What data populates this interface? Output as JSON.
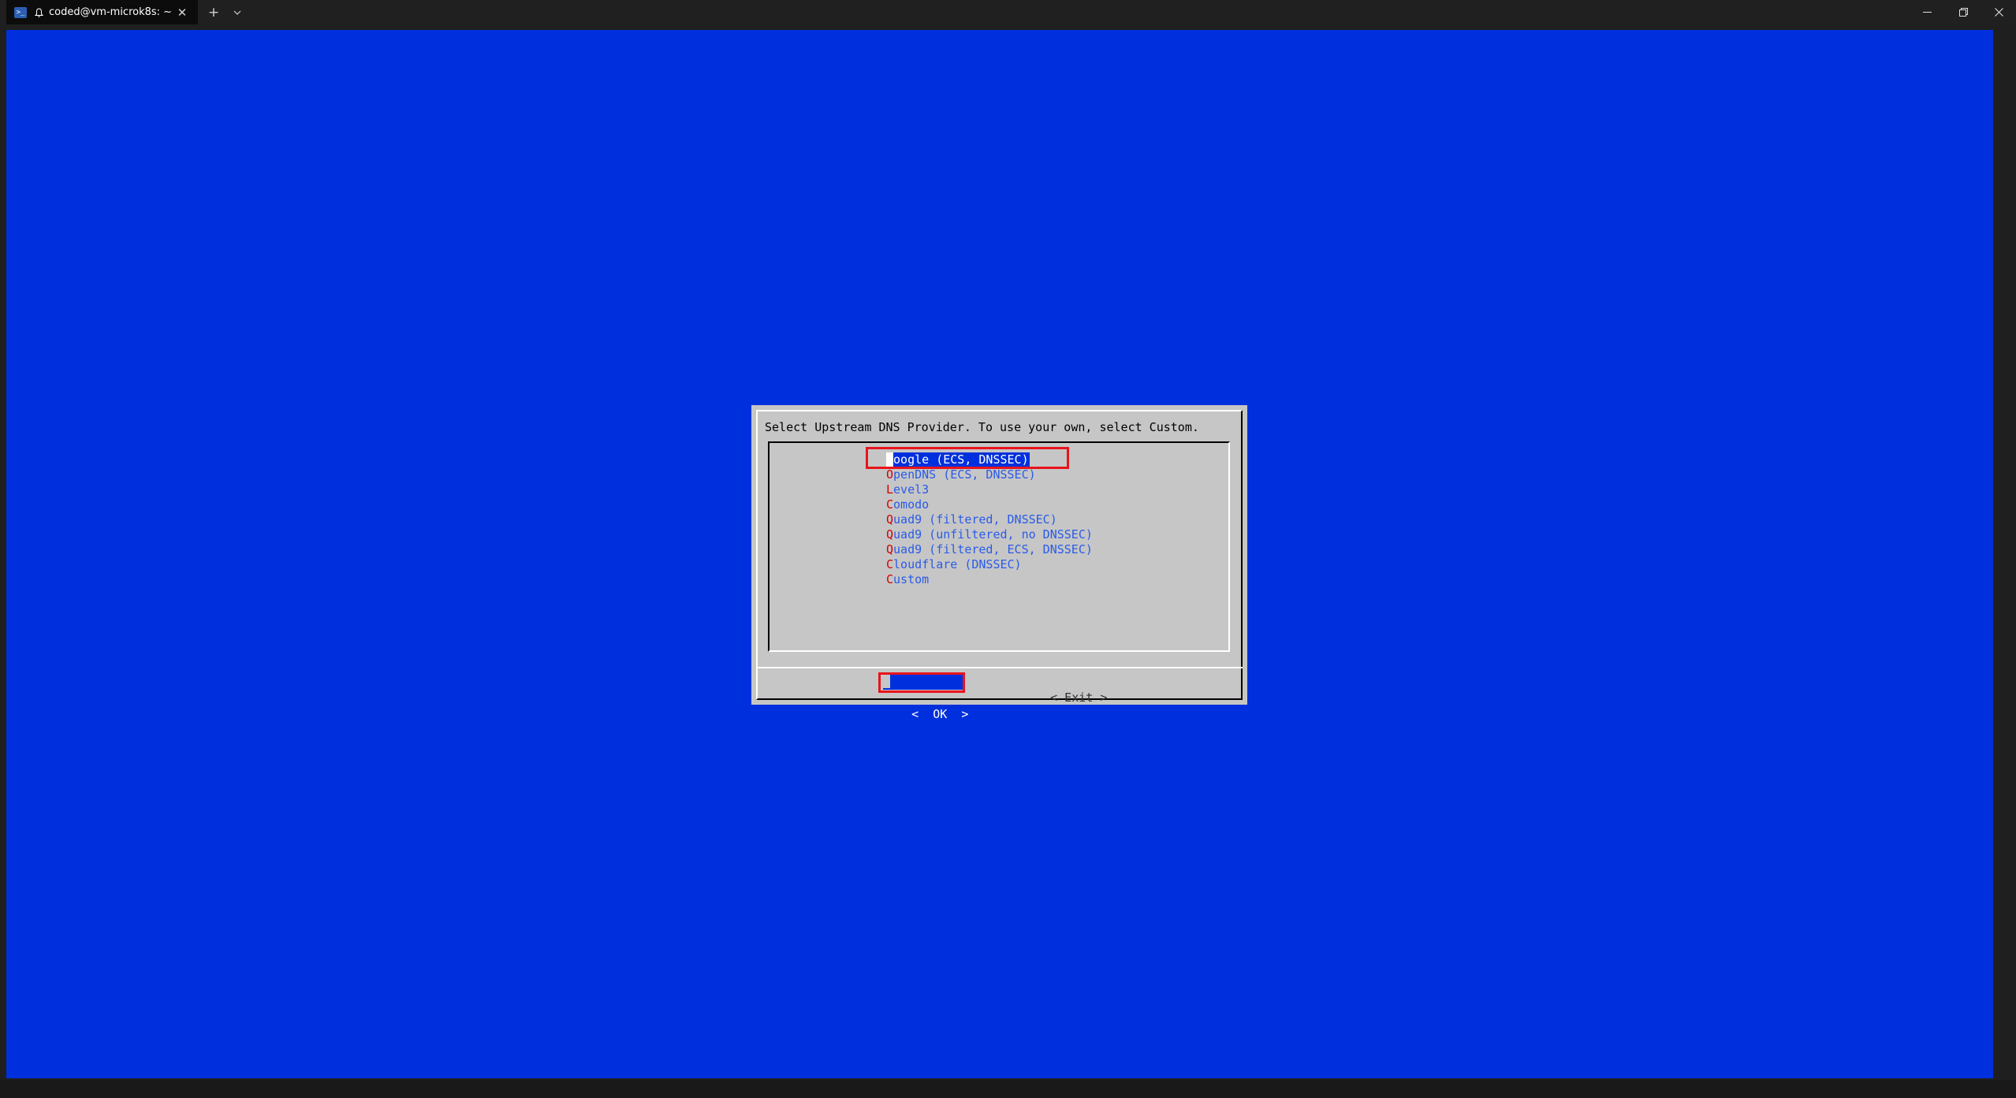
{
  "window": {
    "tab_title": "coded@vm-microk8s: ~",
    "icons": {
      "app": "powershell-icon",
      "notify": "bell-icon",
      "close_tab": "close-icon",
      "new_tab": "plus-icon",
      "dropdown": "chevron-down-icon",
      "minimize": "minimize-icon",
      "maximize": "restore-icon",
      "close": "close-icon"
    },
    "glyphs": {
      "new_tab": "+",
      "dropdown": "⌄",
      "close_tab": "✕",
      "minimize": "—",
      "maximize": "❐",
      "close": "✕"
    }
  },
  "terminal": {
    "background": "#0030dd"
  },
  "dialog": {
    "message": "Select Upstream DNS Provider. To use your own, select Custom.",
    "items": [
      {
        "hot": "G",
        "rest": "oogle (ECS, DNSSEC)",
        "selected": true
      },
      {
        "hot": "O",
        "rest": "penDNS (ECS, DNSSEC)",
        "selected": false
      },
      {
        "hot": "L",
        "rest": "evel3",
        "selected": false
      },
      {
        "hot": "C",
        "rest": "omodo",
        "selected": false
      },
      {
        "hot": "Q",
        "rest": "uad9 (filtered, DNSSEC)",
        "selected": false
      },
      {
        "hot": "Q",
        "rest": "uad9 (unfiltered, no DNSSEC)",
        "selected": false
      },
      {
        "hot": "Q",
        "rest": "uad9 (filtered, ECS, DNSSEC)",
        "selected": false
      },
      {
        "hot": "C",
        "rest": "loudflare (DNSSEC)",
        "selected": false
      },
      {
        "hot": "C",
        "rest": "ustom",
        "selected": false
      }
    ],
    "ok_label": "<  OK  >",
    "exit_label": "< Exit >"
  },
  "colors": {
    "hotkey": "#d40000",
    "item_text": "#2a5be8",
    "annotation": "#e8141c"
  }
}
